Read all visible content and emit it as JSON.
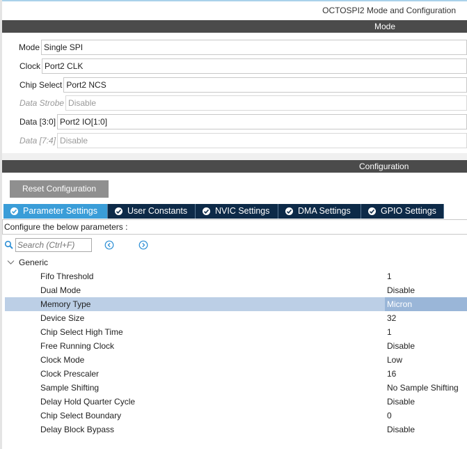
{
  "panel_title": "OCTOSPI2 Mode and Configuration",
  "mode_section": {
    "title": "Mode",
    "fields": [
      {
        "label": "Mode",
        "value": "Single SPI",
        "disabled": false
      },
      {
        "label": "Clock",
        "value": "Port2 CLK",
        "disabled": false
      },
      {
        "label": "Chip Select",
        "value": "Port2 NCS",
        "disabled": false
      },
      {
        "label": "Data Strobe",
        "value": "Disable",
        "disabled": true
      },
      {
        "label": "Data [3:0]",
        "value": "Port2 IO[1:0]",
        "disabled": false
      },
      {
        "label": "Data [7:4]",
        "value": "Disable",
        "disabled": true
      }
    ]
  },
  "config_section": {
    "title": "Configuration",
    "reset_label": "Reset Configuration",
    "tabs": [
      {
        "label": "Parameter Settings",
        "active": true,
        "icon": "check-circle-icon"
      },
      {
        "label": "User Constants",
        "active": false,
        "icon": "check-circle-icon"
      },
      {
        "label": "NVIC Settings",
        "active": false,
        "icon": "check-circle-icon"
      },
      {
        "label": "DMA Settings",
        "active": false,
        "icon": "check-circle-icon"
      },
      {
        "label": "GPIO Settings",
        "active": false,
        "icon": "check-circle-icon"
      }
    ],
    "configure_text": "Configure the below parameters :",
    "search": {
      "placeholder": "Search (Ctrl+F)",
      "value": ""
    },
    "group": {
      "label": "Generic",
      "expanded": true,
      "params": [
        {
          "name": "Fifo Threshold",
          "value": "1",
          "selected": false
        },
        {
          "name": "Dual Mode",
          "value": "Disable",
          "selected": false
        },
        {
          "name": "Memory Type",
          "value": "Micron",
          "selected": true
        },
        {
          "name": "Device Size",
          "value": "32",
          "selected": false
        },
        {
          "name": "Chip Select High Time",
          "value": "1",
          "selected": false
        },
        {
          "name": "Free Running Clock",
          "value": "Disable",
          "selected": false
        },
        {
          "name": "Clock Mode",
          "value": "Low",
          "selected": false
        },
        {
          "name": "Clock Prescaler",
          "value": "16",
          "selected": false
        },
        {
          "name": "Sample Shifting",
          "value": "No Sample Shifting",
          "selected": false
        },
        {
          "name": "Delay Hold Quarter Cycle",
          "value": "Disable",
          "selected": false
        },
        {
          "name": "Chip Select Boundary",
          "value": "0",
          "selected": false
        },
        {
          "name": "Delay Block Bypass",
          "value": "Disable",
          "selected": false
        }
      ]
    }
  },
  "colors": {
    "header_bar": "#4b4b4b",
    "tab_active": "#3a9dd8",
    "tab_inactive": "#0d2a48",
    "selected_row": "#bccfe6",
    "icon_blue": "#2d8fd5"
  }
}
